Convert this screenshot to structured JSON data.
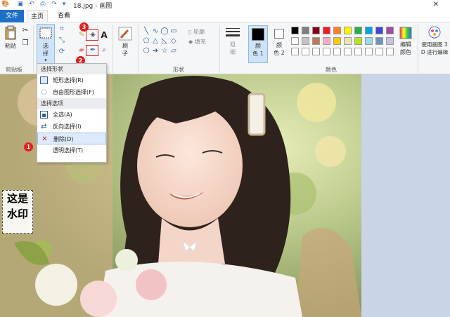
{
  "titlebar": {
    "title": "18.jpg - 画图",
    "close_glyph": "✕"
  },
  "tabs": [
    {
      "label": "文件"
    },
    {
      "label": "主页"
    },
    {
      "label": "查看"
    }
  ],
  "ribbon": {
    "clipboard": {
      "paste": "粘贴",
      "group": "剪贴板"
    },
    "image": {
      "select_line1": "选",
      "select_line2": "择"
    },
    "brush": {
      "line1": "刷",
      "line2": "子"
    },
    "shapes": {
      "outline": "轮廓",
      "fill": "填充",
      "group": "形状"
    },
    "size": {
      "line1": "粗",
      "line2": "细"
    },
    "color1": {
      "line1": "颜",
      "line2": "色 1"
    },
    "color2": {
      "line1": "颜",
      "line2": "色 2"
    },
    "colors_group": "颜色",
    "edit_colors": {
      "line1": "编辑",
      "line2": "颜色"
    },
    "paint3d": {
      "line1": "使用画图 3",
      "line2": "D 进行编辑"
    }
  },
  "palette": [
    "#000000",
    "#7f7f7f",
    "#880015",
    "#ed1c24",
    "#ff7f27",
    "#fff200",
    "#22b14c",
    "#00a2e8",
    "#3f48cc",
    "#a349a4",
    "#ffffff",
    "#c3c3c3",
    "#b97a57",
    "#ffaec9",
    "#ffc90e",
    "#efe4b0",
    "#b5e61d",
    "#99d9ea",
    "#7092be",
    "#c8bfe7"
  ],
  "badges": [
    "3",
    "2",
    "1"
  ],
  "select_menu": {
    "header_shape": "选择形状",
    "rect": "矩形选择(R)",
    "free": "自由图形选择(F)",
    "header_opts": "选择选项",
    "all": "全选(A)",
    "invert": "反向选择(I)",
    "delete": "删除(D)",
    "transparent": "透明选择(T)"
  },
  "watermark": {
    "line1": "这是",
    "line2": "水印"
  },
  "icons": [
    "save-icon",
    "undo-icon",
    "redo-icon",
    "paste-icon",
    "cut-icon",
    "copy-icon",
    "crop-icon",
    "resize-icon",
    "rotate-icon",
    "pencil-icon",
    "fill-icon",
    "text-icon",
    "eraser-icon",
    "color-picker-icon",
    "magnifier-icon",
    "brush-icon",
    "check-icon",
    "close-icon"
  ]
}
